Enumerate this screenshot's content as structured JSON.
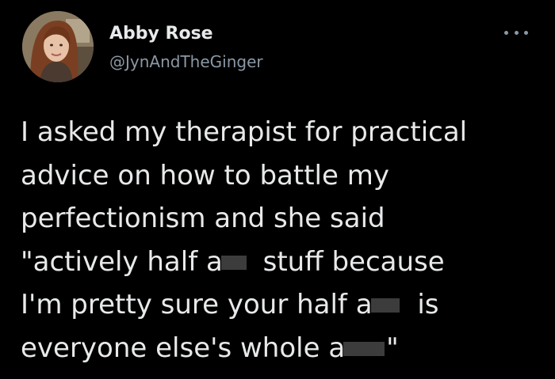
{
  "author": {
    "display_name": "Abby Rose",
    "handle": "@JynAndTheGinger",
    "avatar_icon": "profile-photo"
  },
  "menu": {
    "icon": "more-options-icon"
  },
  "tweet": {
    "lines": [
      "I asked my therapist for practical",
      "advice on how to battle my",
      "perfectionism and she said",
      "\"actively half a",
      " stuff because",
      "I'm pretty sure your half a",
      " is",
      "everyone else's whole a",
      "\""
    ]
  },
  "colors": {
    "background": "#000000",
    "primary_text": "#e7e9ea",
    "secondary_text": "#8b98a5",
    "censor_block": "#3c3c3c"
  }
}
